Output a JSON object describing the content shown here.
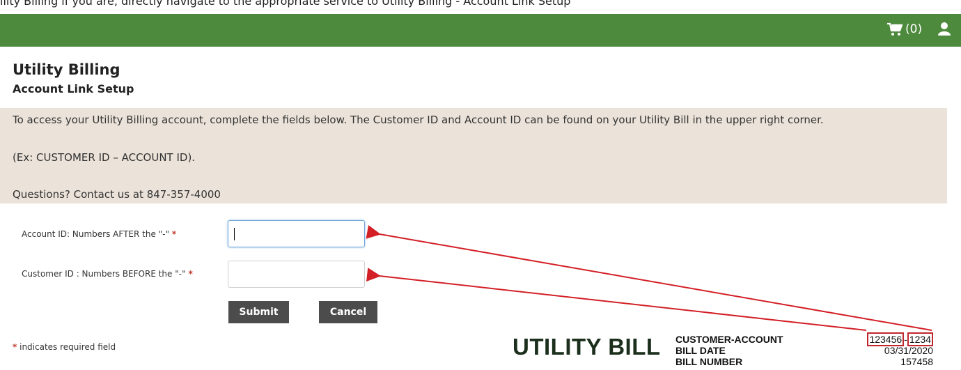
{
  "top_strip_text": "ility Billing if you are, directly navigate to the appropriate service to Utility Billing - Account Link Setup",
  "header": {
    "cart_count": "(0)",
    "cart_icon": "shopping-cart-icon",
    "user_icon": "user-icon",
    "bar_color": "#4e8a3e"
  },
  "page": {
    "title": "Utility Billing",
    "subtitle": "Account Link Setup"
  },
  "info": {
    "line1": "To access your Utility Billing account, complete the fields below. The Customer ID and Account ID can be found on your Utility Bill in the upper right corner.",
    "line2": "(Ex: CUSTOMER ID – ACCOUNT ID).",
    "line3": "Questions? Contact us at 847-357-4000"
  },
  "form": {
    "account_label": "Account ID: Numbers AFTER the \"-\"",
    "account_value": "",
    "customer_label": "Customer ID : Numbers BEFORE the \"-\"",
    "customer_value": "",
    "required_mark": "*",
    "submit_label": "Submit",
    "cancel_label": "Cancel",
    "required_note": "indicates required field"
  },
  "bill_sample": {
    "title": "UTILITY BILL",
    "labels": [
      "CUSTOMER-ACCOUNT",
      "BILL DATE",
      "BILL NUMBER"
    ],
    "customer_number": "123456",
    "separator": "-",
    "account_number": "1234",
    "bill_date": "03/31/2020",
    "bill_number": "157458",
    "highlight_color": "#c0272d"
  }
}
